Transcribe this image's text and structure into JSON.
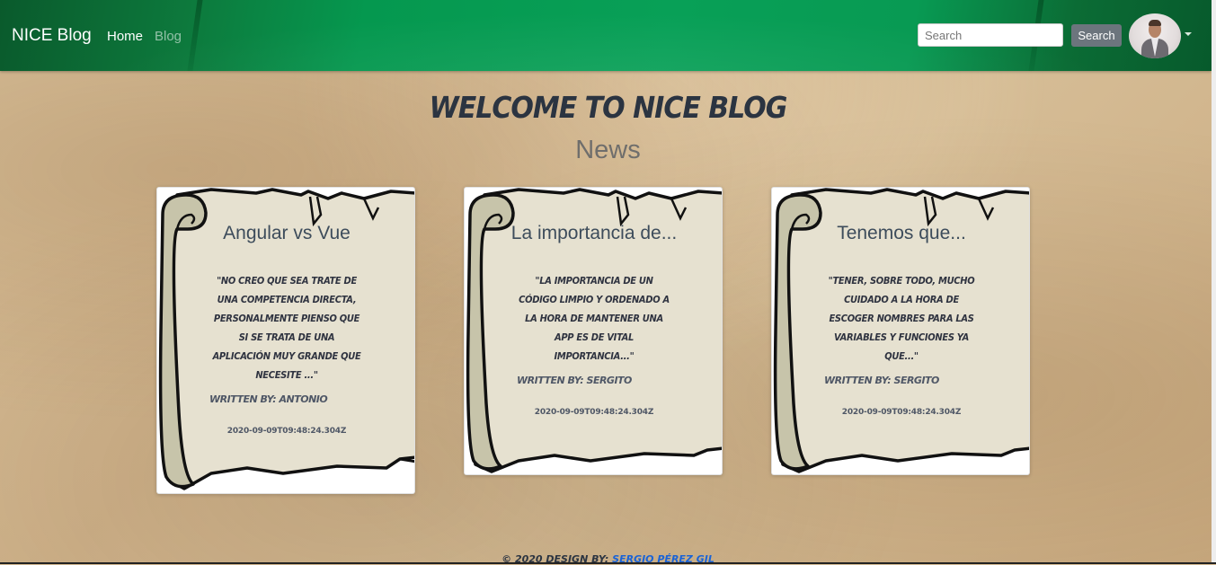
{
  "nav": {
    "brand": "NICE Blog",
    "links": [
      {
        "label": "Home"
      },
      {
        "label": "Blog"
      }
    ],
    "search": {
      "placeholder": "Search",
      "value": "",
      "button_label": "Search"
    }
  },
  "main": {
    "welcome": "WELCOME TO NICE BLOG",
    "section_title": "News"
  },
  "posts": [
    {
      "title": "Angular vs Vue",
      "excerpt": "\"No creo que sea trate de una competencia directa, personalmente pienso que si se trata de una aplicación muy grande que necesite ...\"",
      "author": "Written by: Antonio",
      "date": "2020-09-09T09:48:24.304Z"
    },
    {
      "title": "La importancia de...",
      "excerpt": "\"La importancia de un código limpio y ordenado a la hora de mantener una app es de vital importancia...\"",
      "author": "Written by: Sergito",
      "date": "2020-09-09T09:48:24.304Z"
    },
    {
      "title": "Tenemos que...",
      "excerpt": "\"Tener, sobre todo, mucho cuidado a la hora de escoger nombres para las variables y funciones ya que...\"",
      "author": "Written by: Sergito",
      "date": "2020-09-09T09:48:24.304Z"
    }
  ],
  "footer": {
    "text": "© 2020 Design by:",
    "link": "Sergio Pérez Gil"
  },
  "colors": {
    "navbar": "#08a057",
    "parchment": "#e6e1d0",
    "scroll_outline": "#111111",
    "link": "#1a63d6"
  }
}
